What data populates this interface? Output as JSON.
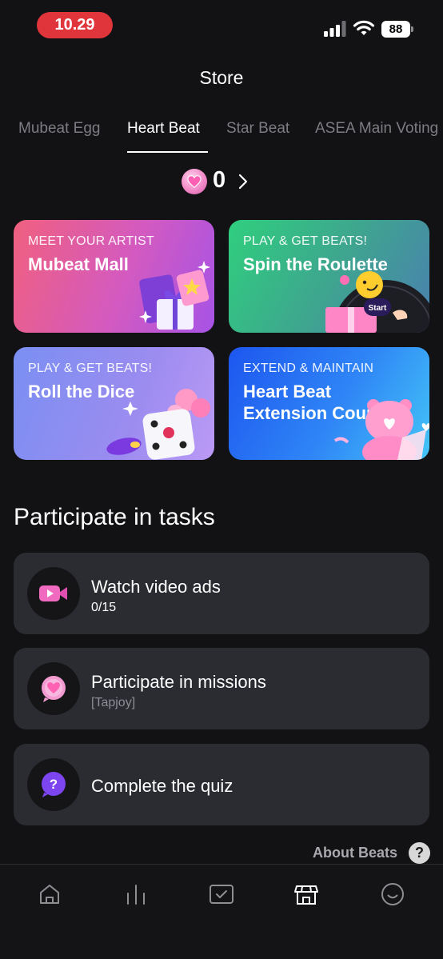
{
  "status_bar": {
    "time": "10.29",
    "battery": "88"
  },
  "header": {
    "title": "Store"
  },
  "tabs": [
    {
      "label": "Mubeat Egg"
    },
    {
      "label": "Heart Beat"
    },
    {
      "label": "Star Beat"
    },
    {
      "label": "ASEA Main Voting"
    }
  ],
  "balance": {
    "value": "0"
  },
  "cards": [
    {
      "kicker": "MEET YOUR ARTIST",
      "title": "Mubeat Mall"
    },
    {
      "kicker": "PLAY & GET BEATS!",
      "title": "Spin the Roulette",
      "art_text": "Start"
    },
    {
      "kicker": "PLAY & GET BEATS!",
      "title": "Roll the Dice"
    },
    {
      "kicker": "EXTEND & MAINTAIN",
      "title": "Heart Beat",
      "title2": "Extension Coupon"
    }
  ],
  "tasks_section": {
    "title": "Participate in tasks",
    "items": [
      {
        "title": "Watch video ads",
        "subtitle": "0/15",
        "icon": "video-camera-icon"
      },
      {
        "title": "Participate in missions",
        "subtitle": "[Tapjoy]",
        "icon": "heart-bubble-icon"
      },
      {
        "title": "Complete the quiz",
        "subtitle": "",
        "icon": "question-bubble-icon"
      }
    ]
  },
  "about": {
    "label": "About Beats",
    "icon_text": "?"
  },
  "nav": [
    {
      "icon": "home-icon"
    },
    {
      "icon": "chart-bars-icon"
    },
    {
      "icon": "vote-box-icon"
    },
    {
      "icon": "store-icon"
    },
    {
      "icon": "profile-smile-icon"
    }
  ],
  "colors": {
    "background": "#121214",
    "card_bg": "#2b2c32",
    "status_time_pill": "#e0353a",
    "tab_inactive": "#7c7c82",
    "accent_pink": "#f28ac8"
  }
}
